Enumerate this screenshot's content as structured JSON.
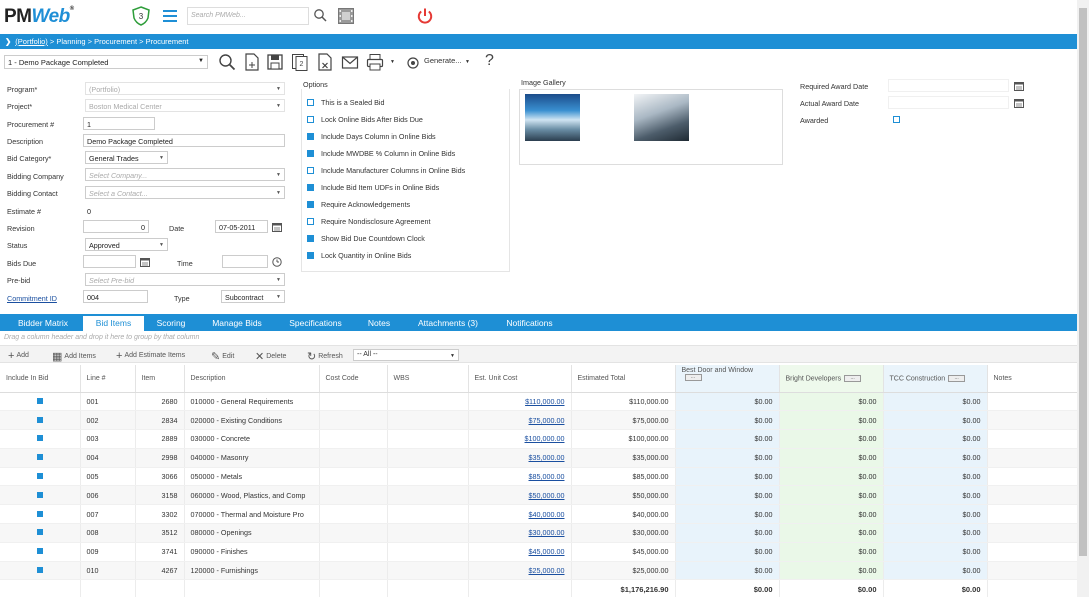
{
  "header": {
    "logo_main": "PM",
    "logo_accent": "Web",
    "logo_mark": "®",
    "notification_count": "3",
    "search_placeholder": "Search PMWeb..."
  },
  "breadcrumb": {
    "root": "(Portfolio)",
    "rest": " > Planning > Procurement > Procurement"
  },
  "toolbar": {
    "record": "1 - Demo Package Completed",
    "generate": "Generate...",
    "help": "?"
  },
  "form": {
    "program_label": "Program*",
    "program_value": "(Portfolio)",
    "project_label": "Project*",
    "project_value": "Boston Medical Center",
    "procurement_label": "Procurement #",
    "procurement_value": "1",
    "description_label": "Description",
    "description_value": "Demo Package Completed",
    "bid_category_label": "Bid Category*",
    "bid_category_value": "General Trades",
    "bidding_company_label": "Bidding Company",
    "bidding_company_placeholder": "Select Company...",
    "bidding_contact_label": "Bidding Contact",
    "bidding_contact_placeholder": "Select a Contact...",
    "estimate_label": "Estimate #",
    "estimate_value": "0",
    "revision_label": "Revision",
    "revision_value": "0",
    "date_label": "Date",
    "date_value": "07-05-2011",
    "status_label": "Status",
    "status_value": "Approved",
    "bids_due_label": "Bids Due",
    "time_label": "Time",
    "prebid_label": "Pre-bid",
    "prebid_placeholder": "Select Pre-bid",
    "commitment_label": "Commitment ID",
    "commitment_value": "004",
    "type_label": "Type",
    "type_value": "Subcontract"
  },
  "options": {
    "title": "Options",
    "items": [
      {
        "label": "This is a Sealed Bid",
        "checked": false
      },
      {
        "label": "Lock Online Bids After Bids Due",
        "checked": false
      },
      {
        "label": "Include Days Column in Online Bids",
        "checked": true
      },
      {
        "label": "Include MWDBE % Column in Online Bids",
        "checked": true
      },
      {
        "label": "Include Manufacturer Columns in Online Bids",
        "checked": false
      },
      {
        "label": "Include Bid Item UDFs in Online Bids",
        "checked": true
      },
      {
        "label": "Require Acknowledgements",
        "checked": true
      },
      {
        "label": "Require Nondisclosure Agreement",
        "checked": false
      },
      {
        "label": "Show Bid Due Countdown Clock",
        "checked": true
      },
      {
        "label": "Lock Quantity in Online Bids",
        "checked": true
      }
    ]
  },
  "gallery": {
    "title": "Image Gallery"
  },
  "award": {
    "required_label": "Required Award Date",
    "actual_label": "Actual Award Date",
    "awarded_label": "Awarded"
  },
  "tabs": [
    {
      "label": "Bidder Matrix",
      "active": false
    },
    {
      "label": "Bid Items",
      "active": true
    },
    {
      "label": "Scoring",
      "active": false
    },
    {
      "label": "Manage Bids",
      "active": false
    },
    {
      "label": "Specifications",
      "active": false
    },
    {
      "label": "Notes",
      "active": false
    },
    {
      "label": "Attachments (3)",
      "active": false
    },
    {
      "label": "Notifications",
      "active": false
    }
  ],
  "grid": {
    "group_hint": "Drag a column header and drop it here to group by that column",
    "add": "Add",
    "add_items": "Add Items",
    "add_estimate": "Add Estimate Items",
    "edit": "Edit",
    "delete": "Delete",
    "refresh": "Refresh",
    "filter": "-- All --",
    "columns": [
      "Include In Bid",
      "Line #",
      "Item",
      "Description",
      "Cost Code",
      "WBS",
      "Est. Unit Cost",
      "Estimated Total",
      "Best Door and Window",
      "Bright Developers",
      "TCC Construction",
      "Notes"
    ],
    "column_button": "...",
    "rows": [
      {
        "line": "001",
        "item": "2680",
        "desc": "010000 - General Requirements",
        "unit": "$110,000.00",
        "total": "$110,000.00",
        "b1": "$0.00",
        "b2": "$0.00",
        "b3": "$0.00"
      },
      {
        "line": "002",
        "item": "2834",
        "desc": "020000 - Existing Conditions",
        "unit": "$75,000.00",
        "total": "$75,000.00",
        "b1": "$0.00",
        "b2": "$0.00",
        "b3": "$0.00"
      },
      {
        "line": "003",
        "item": "2889",
        "desc": "030000 - Concrete",
        "unit": "$100,000.00",
        "total": "$100,000.00",
        "b1": "$0.00",
        "b2": "$0.00",
        "b3": "$0.00"
      },
      {
        "line": "004",
        "item": "2998",
        "desc": "040000 - Masonry",
        "unit": "$35,000.00",
        "total": "$35,000.00",
        "b1": "$0.00",
        "b2": "$0.00",
        "b3": "$0.00"
      },
      {
        "line": "005",
        "item": "3066",
        "desc": "050000 - Metals",
        "unit": "$85,000.00",
        "total": "$85,000.00",
        "b1": "$0.00",
        "b2": "$0.00",
        "b3": "$0.00"
      },
      {
        "line": "006",
        "item": "3158",
        "desc": "060000 - Wood, Plastics, and Comp",
        "unit": "$50,000.00",
        "total": "$50,000.00",
        "b1": "$0.00",
        "b2": "$0.00",
        "b3": "$0.00"
      },
      {
        "line": "007",
        "item": "3302",
        "desc": "070000 - Thermal and Moisture Pro",
        "unit": "$40,000.00",
        "total": "$40,000.00",
        "b1": "$0.00",
        "b2": "$0.00",
        "b3": "$0.00"
      },
      {
        "line": "008",
        "item": "3512",
        "desc": "080000 - Openings",
        "unit": "$30,000.00",
        "total": "$30,000.00",
        "b1": "$0.00",
        "b2": "$0.00",
        "b3": "$0.00"
      },
      {
        "line": "009",
        "item": "3741",
        "desc": "090000 - Finishes",
        "unit": "$45,000.00",
        "total": "$45,000.00",
        "b1": "$0.00",
        "b2": "$0.00",
        "b3": "$0.00"
      },
      {
        "line": "010",
        "item": "4267",
        "desc": "120000 - Furnishings",
        "unit": "$25,000.00",
        "total": "$25,000.00",
        "b1": "$0.00",
        "b2": "$0.00",
        "b3": "$0.00"
      }
    ],
    "totals": {
      "total": "$1,176,216.90",
      "b1": "$0.00",
      "b2": "$0.00",
      "b3": "$0.00"
    }
  },
  "colors": {
    "accent": "#1e8fd5",
    "power": "#e53935"
  }
}
